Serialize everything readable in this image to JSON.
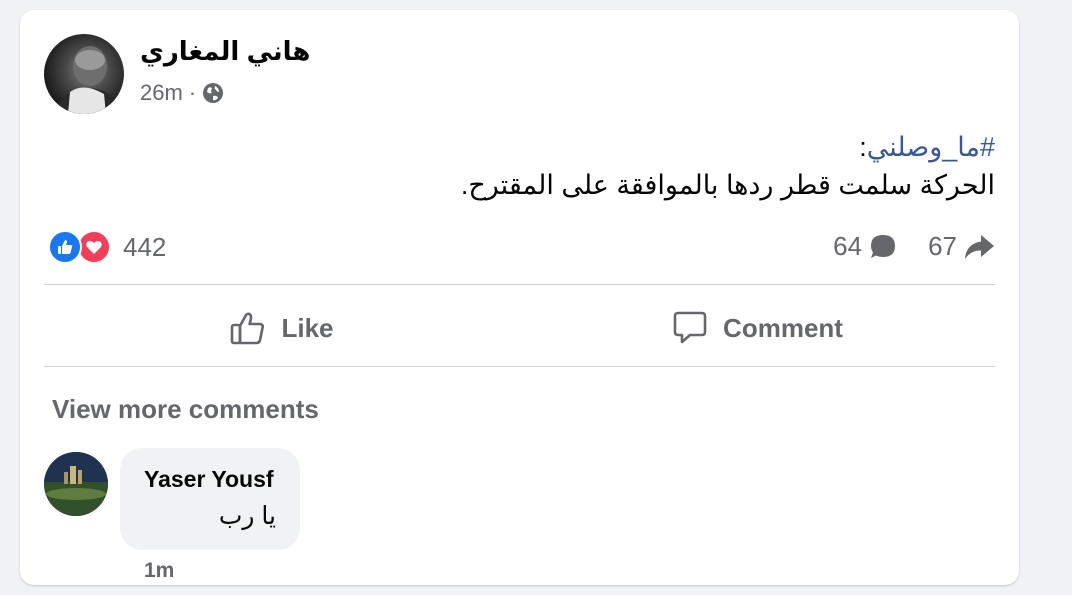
{
  "post": {
    "author": "هاني المغاري",
    "timestamp": "26m",
    "separator": "·",
    "audience_icon": "globe-icon",
    "hashtag": "#ما_وصلني",
    "hashtag_suffix": ":",
    "text": "الحركة سلمت قطر ردها بالموافقة على المقترح."
  },
  "reactions": {
    "icons": [
      "like-icon",
      "love-icon"
    ],
    "count": "442",
    "comments_count": "64",
    "comments_icon": "comment-bubble-icon",
    "shares_count": "67",
    "shares_icon": "share-arrow-icon"
  },
  "actions": {
    "like_label": "Like",
    "comment_label": "Comment"
  },
  "comments": {
    "view_more_label": "View more comments",
    "items": [
      {
        "author": "Yaser Yousf",
        "text": "يا رب",
        "time": "1m"
      }
    ]
  },
  "colors": {
    "background": "#f0f2f5",
    "card": "#ffffff",
    "hashtag": "#385898",
    "secondary_text": "#65676b",
    "like_blue": "#1877f2",
    "love_red": "#f33e58"
  }
}
